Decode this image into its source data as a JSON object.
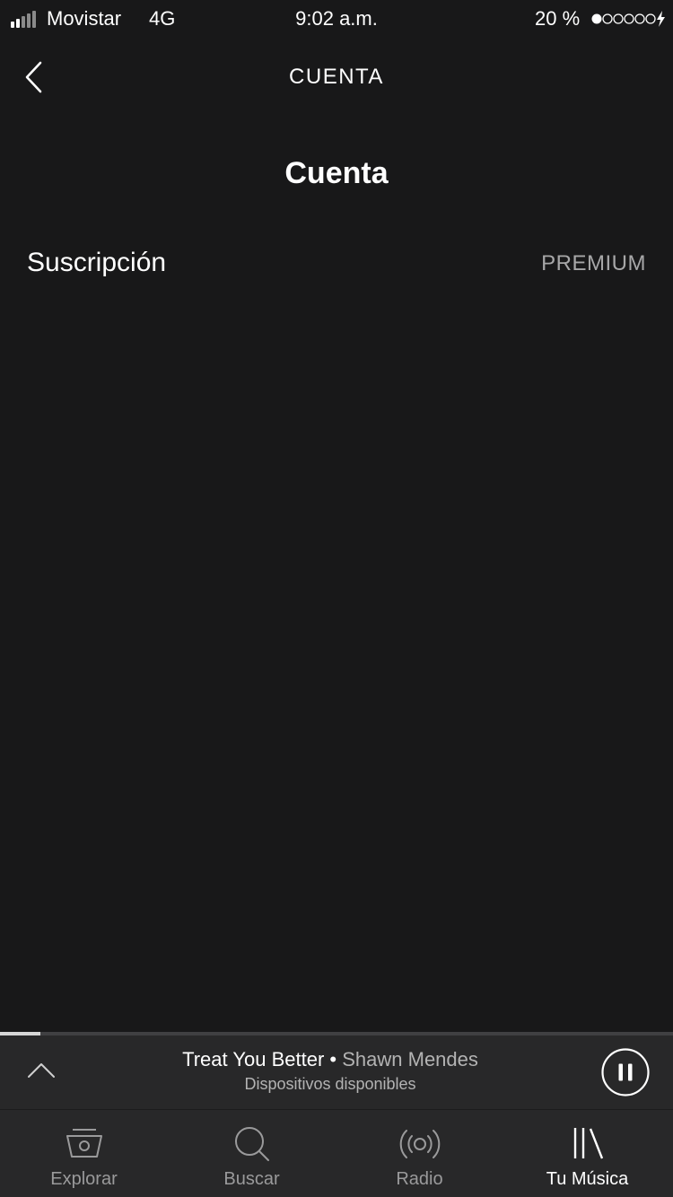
{
  "status_bar": {
    "carrier": "Movistar",
    "network": "4G",
    "time": "9:02 a.m.",
    "battery_percent": "20 %",
    "signal_bars_filled": 2,
    "signal_bars_total": 5,
    "battery_dots_filled": 1,
    "battery_dots_total": 6,
    "icons": [
      "signal-icon",
      "battery-dots-icon",
      "charging-icon"
    ]
  },
  "navbar": {
    "title": "CUENTA",
    "back_icon": "chevron-left-icon"
  },
  "page": {
    "title": "Cuenta",
    "rows": [
      {
        "label": "Suscripción",
        "value": "PREMIUM"
      }
    ]
  },
  "mini_player": {
    "track": "Treat You Better",
    "separator": " • ",
    "artist": "Shawn Mendes",
    "device_text": "Dispositivos disponibles",
    "progress_fraction": 0.06,
    "expand_icon": "chevron-up-icon",
    "pause_icon": "pause-icon"
  },
  "tabs": [
    {
      "label": "Explorar",
      "icon": "explore-icon",
      "active": false
    },
    {
      "label": "Buscar",
      "icon": "search-icon",
      "active": false
    },
    {
      "label": "Radio",
      "icon": "radio-icon",
      "active": false
    },
    {
      "label": "Tu Música",
      "icon": "library-icon",
      "active": true
    }
  ],
  "colors": {
    "background": "#181819",
    "bar_background": "#282829",
    "text_primary": "#ffffff",
    "text_secondary": "#a7a7a8",
    "tab_inactive": "#9a9a9b"
  }
}
